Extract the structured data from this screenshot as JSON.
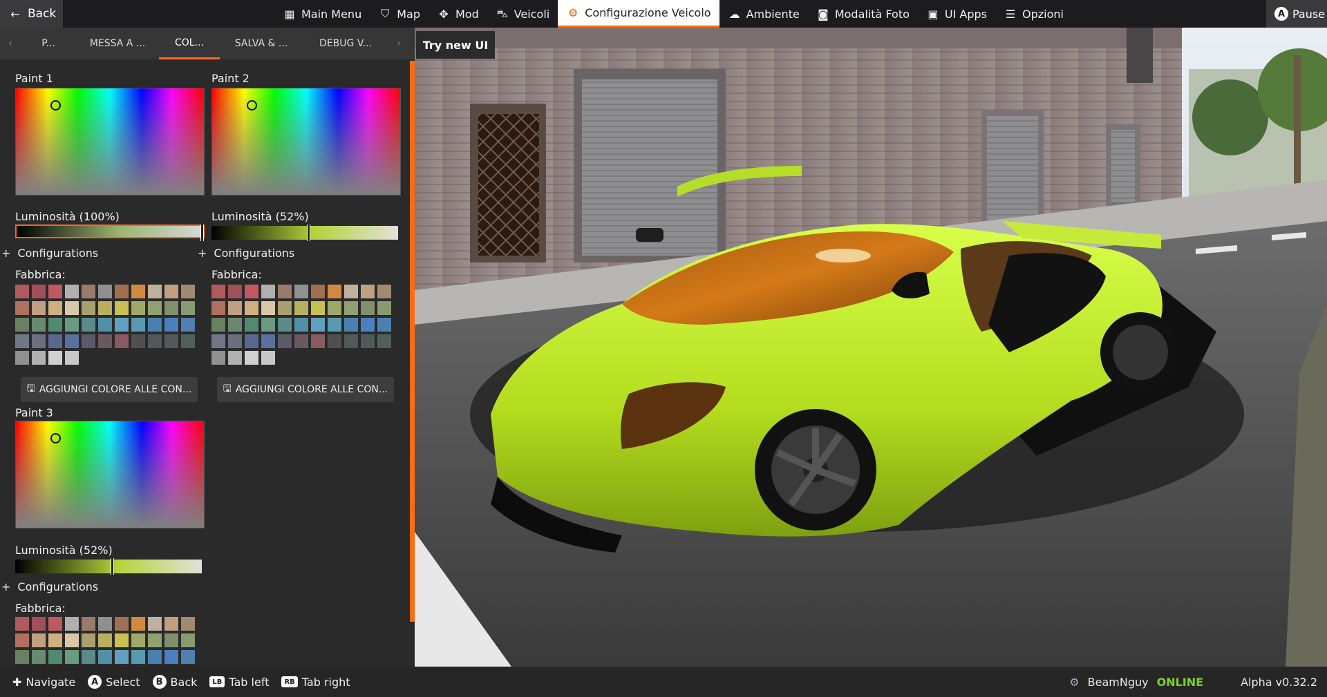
{
  "topbar": {
    "back_label": "Back",
    "nav": [
      {
        "label": "Main Menu",
        "icon": "main-menu-icon"
      },
      {
        "label": "Map",
        "icon": "map-icon"
      },
      {
        "label": "Mod",
        "icon": "puzzle-icon"
      },
      {
        "label": "Veicoli",
        "icon": "car-icon"
      },
      {
        "label": "Configurazione Veicolo",
        "icon": "engine-icon",
        "active": true
      },
      {
        "label": "Ambiente",
        "icon": "weather-icon"
      },
      {
        "label": "Modalità Foto",
        "icon": "camera-icon"
      },
      {
        "label": "UI Apps",
        "icon": "ui-apps-icon"
      },
      {
        "label": "Opzioni",
        "icon": "sliders-icon"
      }
    ],
    "pause_badge": "A",
    "pause_label": "Pause"
  },
  "subtabs": [
    {
      "label": "P..."
    },
    {
      "label": "MESSA A ..."
    },
    {
      "label": "COL...",
      "active": true
    },
    {
      "label": "SALVA & ..."
    },
    {
      "label": "DEBUG V..."
    }
  ],
  "try_new_ui": "Try new UI",
  "paints": [
    {
      "label": "Paint 1",
      "luminosity_label": "Luminosità (100%)",
      "luminosity": 1.0,
      "cursor": [
        0.2,
        0.15
      ],
      "color": "#9fb370"
    },
    {
      "label": "Paint 2",
      "luminosity_label": "Luminosità (52%)",
      "luminosity": 0.52,
      "cursor": [
        0.2,
        0.15
      ],
      "color": "#b5d33a"
    },
    {
      "label": "Paint 3",
      "luminosity_label": "Luminosità (52%)",
      "luminosity": 0.52,
      "cursor": [
        0.2,
        0.15
      ],
      "color": "#b5d33a"
    }
  ],
  "configurations_label": "Configurations",
  "factory_label": "Fabbrica:",
  "add_color_button": "AGGIUNGI COLORE ALLE CON...",
  "swatches": [
    "#b05a5f",
    "#a0505a",
    "#c05a60",
    "#b0b0b0",
    "#9a7a6a",
    "#909090",
    "#a07050",
    "#d08a40",
    "#c0b0a0",
    "#c0a080",
    "#a08a70",
    "#b07060",
    "#c0a080",
    "#d0b080",
    "#d8c8a8",
    "#a8a070",
    "#b8b060",
    "#c8c050",
    "#a0a868",
    "#90a070",
    "#80906a",
    "#8a9a70",
    "#6a8060",
    "#6a8a70",
    "#508a70",
    "#6a9a80",
    "#5a8a8a",
    "#5090a8",
    "#60a0c0",
    "#5a9ab0",
    "#4a80b0",
    "#4a80c0",
    "#5080b0",
    "#707888",
    "#6a7080",
    "#5a6890",
    "#5a70a0",
    "#5a5a68",
    "#6a5a60",
    "#8a5a60",
    "#505050",
    "#505858",
    "#505a58",
    "#506058",
    "#909090",
    "#b0b0b0",
    "#d0d0d0",
    "#c8c8c8"
  ],
  "swatches_short": [
    "#b05a5f",
    "#a0505a",
    "#c05a60",
    "#b0b0b0",
    "#9a7a6a",
    "#909090",
    "#a07050",
    "#d08a40",
    "#c0b0a0",
    "#c0a080",
    "#a08a70",
    "#b07060",
    "#c0a080",
    "#d0b080",
    "#d8c8a8",
    "#a8a070",
    "#b8b060",
    "#c8c050",
    "#a0a868",
    "#90a070",
    "#80906a",
    "#8a9a70",
    "#6a8060",
    "#6a8a70",
    "#508a70",
    "#6a9a80",
    "#5a8a8a",
    "#5090a8",
    "#60a0c0",
    "#5a9ab0",
    "#4a80b0",
    "#4a80c0",
    "#5080b0"
  ],
  "bottombar": {
    "hints": [
      {
        "badge": "✚",
        "label": "Navigate"
      },
      {
        "badge": "A",
        "label": "Select"
      },
      {
        "badge": "B",
        "label": "Back"
      },
      {
        "badge": "LB",
        "label": "Tab left"
      },
      {
        "badge": "RB",
        "label": "Tab right"
      }
    ],
    "user": "BeamNguy",
    "online": "ONLINE",
    "version": "Alpha v0.32.2"
  },
  "colors": {
    "accent": "#ff6a13",
    "online": "#7bd421"
  }
}
